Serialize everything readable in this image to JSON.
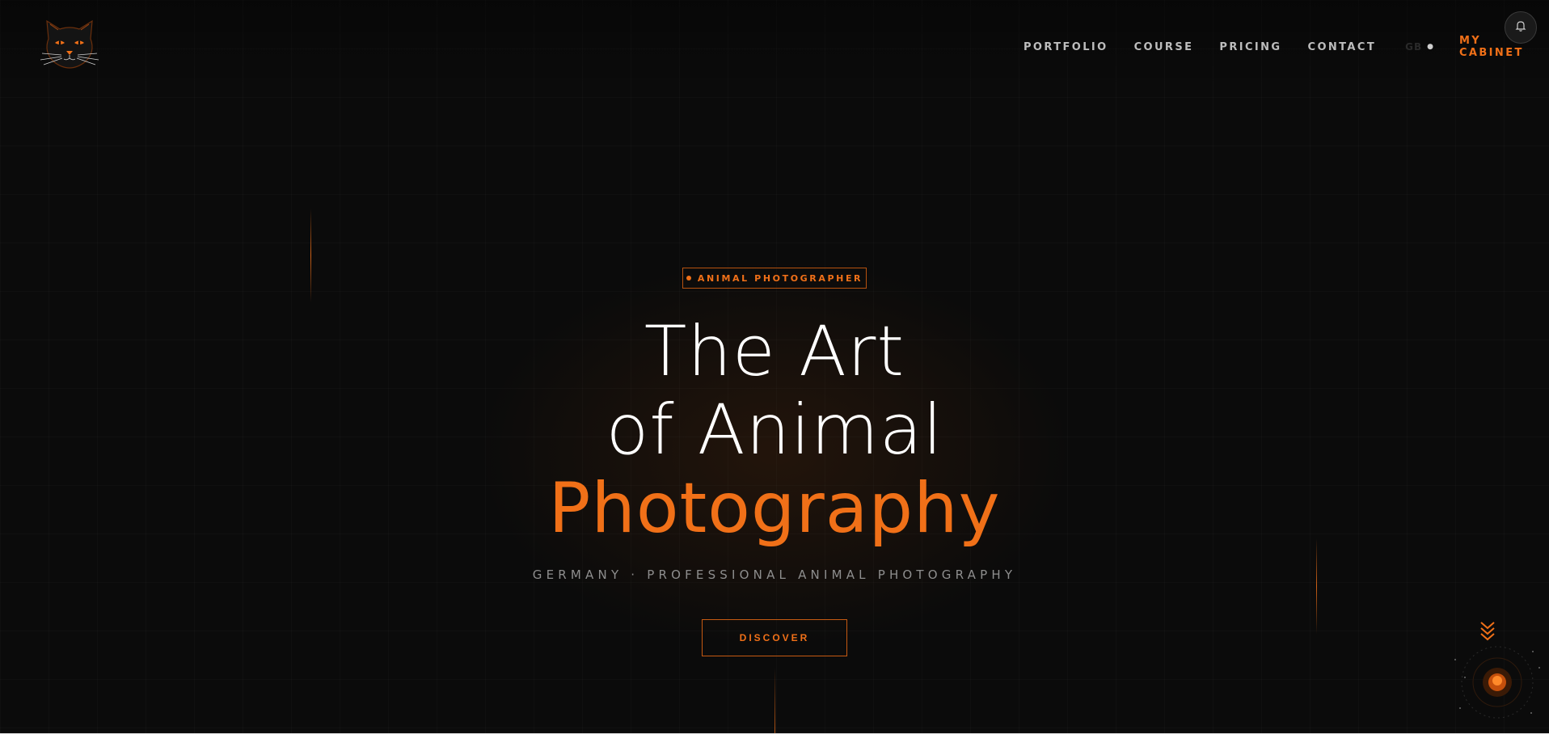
{
  "brand": {
    "logo_icon": "cat-face-icon",
    "accent": "#f07018"
  },
  "nav": {
    "items": [
      "PORTFOLIO",
      "COURSE",
      "PRICING",
      "CONTACT"
    ],
    "language": "GB",
    "cabinet": "MY CABINET"
  },
  "notifications": {
    "icon": "bell-icon"
  },
  "hero": {
    "badge": "ANIMAL PHOTOGRAPHER",
    "title_line1": "The Art",
    "title_line2": "of Animal",
    "title_line3": "Photography",
    "subtitle": "GERMANY · PROFESSIONAL ANIMAL PHOTOGRAPHY",
    "cta": "DISCOVER"
  },
  "scroll": {
    "icon": "chevron-double-down-icon"
  }
}
